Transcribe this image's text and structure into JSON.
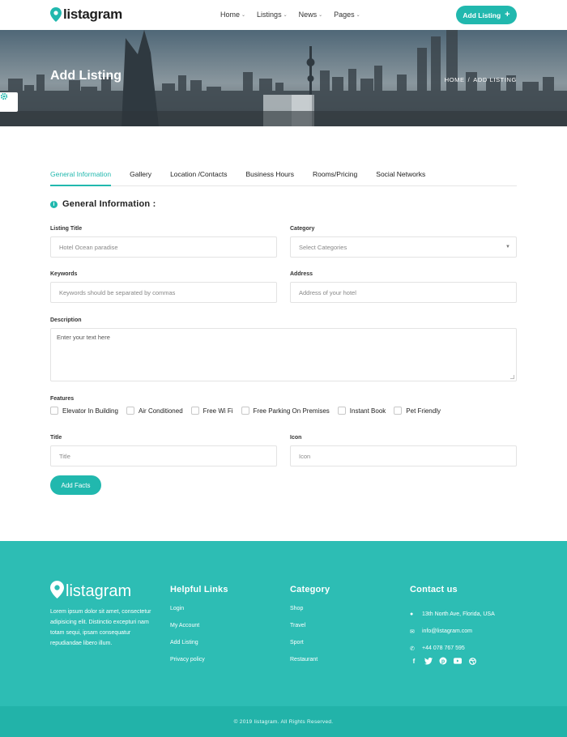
{
  "brand": {
    "name": "listagram"
  },
  "nav": {
    "items": [
      {
        "label": "Home"
      },
      {
        "label": "Listings"
      },
      {
        "label": "News"
      },
      {
        "label": "Pages"
      }
    ],
    "cta": "Add Listing"
  },
  "hero": {
    "title": "Add Listing",
    "breadcrumb": [
      "HOME",
      "/",
      "ADD LISTING"
    ]
  },
  "tabs": [
    {
      "label": "General Information",
      "active": true
    },
    {
      "label": "Gallery"
    },
    {
      "label": "Location /Contacts"
    },
    {
      "label": "Business Hours"
    },
    {
      "label": "Rooms/Pricing"
    },
    {
      "label": "Social Networks"
    }
  ],
  "form": {
    "section_title": "General Information :",
    "listing_title": {
      "label": "Listing Title",
      "placeholder": "Hotel Ocean paradise"
    },
    "category": {
      "label": "Category",
      "placeholder": "Select Categories"
    },
    "keywords": {
      "label": "Keywords",
      "placeholder": "Keywords should be separated by commas"
    },
    "address": {
      "label": "Address",
      "placeholder": "Address of your hotel"
    },
    "description": {
      "label": "Description",
      "placeholder": "Enter your text here"
    },
    "features_label": "Features",
    "features": [
      "Elevator In Building",
      "Air Conditioned",
      "Free Wi Fi",
      "Free Parking On Premises",
      "Instant Book",
      "Pet Friendly"
    ],
    "fact_title": {
      "label": "Title",
      "placeholder": "Title"
    },
    "fact_icon": {
      "label": "Icon",
      "placeholder": "Icon"
    },
    "add_facts": "Add Facts"
  },
  "footer": {
    "about": "Lorem ipsum dolor sit amet, consectetur adipisicing elit. Distinctio excepturi nam totam sequi, ipsam consequatur repudiandae libero illum.",
    "helpful_title": "Helpful Links",
    "helpful_links": [
      "Login",
      "My Account",
      "Add Listing",
      "Privacy policy"
    ],
    "category_title": "Category",
    "category_links": [
      "Shop",
      "Travel",
      "Sport",
      "Restaurant"
    ],
    "contact_title": "Contact us",
    "contact": {
      "address": "13th North Ave, Florida, USA",
      "email": "info@listagram.com",
      "phone": "+44 078 767 595"
    },
    "socials": [
      "facebook-icon",
      "twitter-icon",
      "pinterest-icon",
      "youtube-icon",
      "dribbble-icon"
    ],
    "copyright": "© 2019 listagram. All Rights Reserved."
  },
  "colors": {
    "accent": "#21b8ae",
    "footer": "#2dbdb4",
    "footer_bottom": "#22b3a9"
  }
}
